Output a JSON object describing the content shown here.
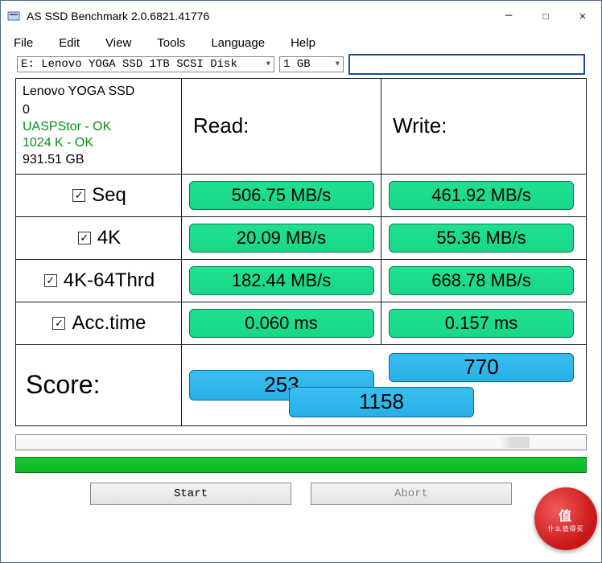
{
  "window": {
    "title": "AS SSD Benchmark 2.0.6821.41776"
  },
  "menu": {
    "file": "File",
    "edit": "Edit",
    "view": "View",
    "tools": "Tools",
    "language": "Language",
    "help": "Help"
  },
  "toolbar": {
    "drive": "E: Lenovo YOGA SSD 1TB SCSI Disk",
    "size": "1 GB"
  },
  "device": {
    "name": "Lenovo YOGA SSD",
    "zero": "0",
    "driver": "UASPStor - OK",
    "align": "1024 K - OK",
    "capacity": "931.51 GB"
  },
  "headers": {
    "read": "Read:",
    "write": "Write:"
  },
  "tests": {
    "seq": {
      "label": "Seq",
      "read": "506.75 MB/s",
      "write": "461.92 MB/s"
    },
    "k4": {
      "label": "4K",
      "read": "20.09 MB/s",
      "write": "55.36 MB/s"
    },
    "k4t": {
      "label": "4K-64Thrd",
      "read": "182.44 MB/s",
      "write": "668.78 MB/s"
    },
    "acc": {
      "label": "Acc.time",
      "read": "0.060 ms",
      "write": "0.157 ms"
    }
  },
  "score": {
    "label": "Score:",
    "read": "253",
    "write": "770",
    "total": "1158"
  },
  "buttons": {
    "start": "Start",
    "abort": "Abort"
  },
  "watermark": {
    "line1": "值",
    "line2": "什么值得买"
  }
}
